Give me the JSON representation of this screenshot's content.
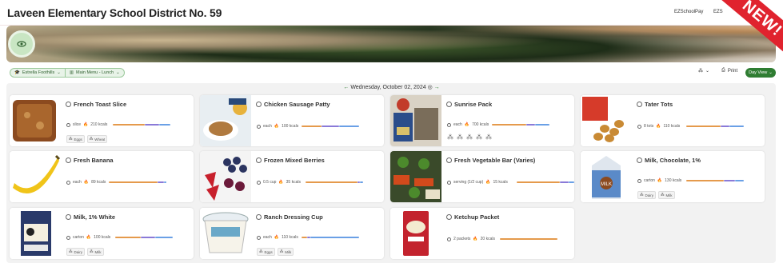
{
  "header": {
    "title": "Laveen Elementary School District No. 59",
    "links": [
      "EZSchoolPay",
      "EZS"
    ],
    "ribbon_text": "NEW!"
  },
  "filters": {
    "school": "Estrella Foothills",
    "menu": "Main Menu - Lunch"
  },
  "toolbar": {
    "print_label": "Print",
    "view_label": "Day View"
  },
  "date_nav": {
    "date": "Wednesday, October 02, 2024"
  },
  "colors": {
    "accent": "#2f7d32",
    "bar_carb": "#e59a4c",
    "bar_protein": "#8a7ad8",
    "bar_fat": "#6aa0e6"
  },
  "items": [
    {
      "name": "French Toast Slice",
      "serving": "slice",
      "kcal": "210 kcals",
      "tags": [
        "Eggs",
        "Wheat"
      ],
      "bar": [
        0.55,
        0.25,
        0.2
      ],
      "img": "toast"
    },
    {
      "name": "Chicken Sausage Patty",
      "serving": "each",
      "kcal": "100 kcals",
      "tags": [],
      "bar": [
        0.35,
        0.3,
        0.35
      ],
      "img": "patty"
    },
    {
      "name": "Sunrise Pack",
      "serving": "each",
      "kcal": "700 kcals",
      "tags": [],
      "bar": [
        0.6,
        0.15,
        0.25
      ],
      "img": "pack",
      "icons": 5
    },
    {
      "name": "Tater Tots",
      "serving": "8 tots",
      "kcal": "110 kcals",
      "tags": [],
      "bar": [
        0.6,
        0.15,
        0.25
      ],
      "img": "tots"
    },
    {
      "name": "Fresh Banana",
      "serving": "each",
      "kcal": "89 kcals",
      "tags": [],
      "bar": [
        0.85,
        0.1,
        0.05
      ],
      "img": "banana"
    },
    {
      "name": "Frozen Mixed Berries",
      "serving": "0.5 cup",
      "kcal": "35 kcals",
      "tags": [],
      "bar": [
        0.9,
        0.05,
        0.05
      ],
      "img": "berries"
    },
    {
      "name": "Fresh Vegetable Bar (Varies)",
      "serving": "serving (1/2 cup)",
      "kcal": "15 kcals",
      "tags": [],
      "bar": [
        0.75,
        0.15,
        0.1
      ],
      "img": "veg"
    },
    {
      "name": "Milk, Chocolate, 1%",
      "serving": "carton",
      "kcal": "130 kcals",
      "tags": [
        "Dairy",
        "Milk"
      ],
      "bar": [
        0.65,
        0.2,
        0.15
      ],
      "img": "chocmilk"
    },
    {
      "name": "Milk, 1% White",
      "serving": "carton",
      "kcal": "100 kcals",
      "tags": [
        "Dairy",
        "Milk"
      ],
      "bar": [
        0.45,
        0.25,
        0.3
      ],
      "img": "milk"
    },
    {
      "name": "Ranch Dressing Cup",
      "serving": "each",
      "kcal": "110 kcals",
      "tags": [
        "Eggs",
        "Milk"
      ],
      "bar": [
        0.1,
        0.05,
        0.85
      ],
      "img": "ranch"
    },
    {
      "name": "Ketchup Packet",
      "serving": "2 packets",
      "kcal": "20 kcals",
      "tags": [],
      "bar": [
        1.0,
        0,
        0
      ],
      "img": "ketchup"
    }
  ]
}
